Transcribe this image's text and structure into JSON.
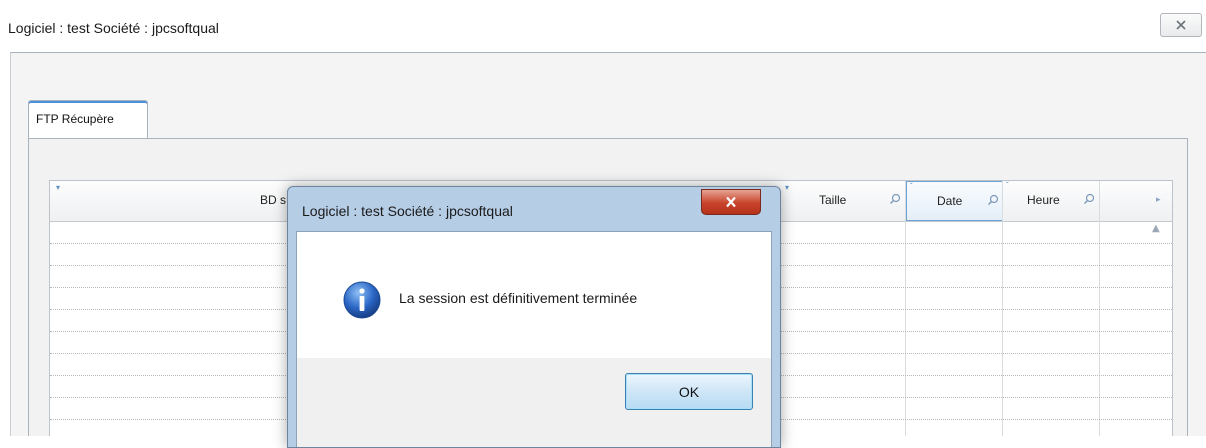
{
  "window": {
    "title": "Logiciel : test Société : jpcsoftqual",
    "close_icon": "close-x-icon"
  },
  "tabs": [
    {
      "label": "FTP Récupère",
      "active": true
    }
  ],
  "grid": {
    "columns": [
      {
        "label": "BD s",
        "filter": false
      },
      {
        "label": "Taille",
        "filter": true
      },
      {
        "label": "Date",
        "filter": true
      },
      {
        "label": "Heure",
        "filter": true
      }
    ],
    "rows": []
  },
  "dialog": {
    "title": "Logiciel : test Société : jpcsoftqual",
    "message": "La session est définitivement terminée",
    "icon": "info-icon",
    "ok_label": "OK",
    "close_icon": "close-x-icon"
  },
  "colors": {
    "accent": "#4d8fd6",
    "dialog_frame": "#b6cde6",
    "close_red": "#c9432b",
    "info_blue": "#2b67c6"
  }
}
